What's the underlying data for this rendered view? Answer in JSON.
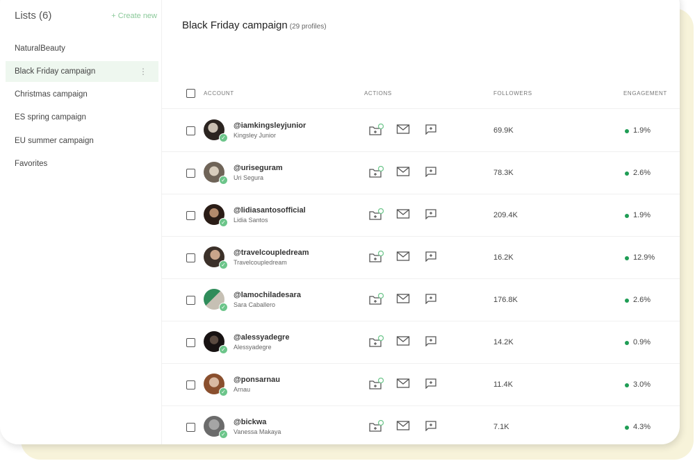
{
  "sidebar": {
    "title": "Lists (6)",
    "create_link": "+ Create new",
    "items": [
      {
        "label": "NaturalBeauty"
      },
      {
        "label": "Black Friday campaign"
      },
      {
        "label": "Christmas campaign"
      },
      {
        "label": "ES spring campaign"
      },
      {
        "label": "EU summer campaign"
      },
      {
        "label": "Favorites"
      }
    ],
    "active_index": 1,
    "menu_glyph": "⋮"
  },
  "main": {
    "title": "Black Friday campaign",
    "count": "(29 profiles)",
    "columns": {
      "account": "ACCOUNT",
      "actions": "ACTIONS",
      "followers": "FOLLOWERS",
      "engagement": "ENGAGEMENT"
    },
    "rows": [
      {
        "handle": "@iamkingsleyjunior",
        "name": "Kingsley Junior",
        "followers": "69.9K",
        "engagement": "1.9%"
      },
      {
        "handle": "@uriseguram",
        "name": "Uri Segura",
        "followers": "78.3K",
        "engagement": "2.6%"
      },
      {
        "handle": "@lidiasantosofficial",
        "name": "Lidia Santos",
        "followers": "209.4K",
        "engagement": "1.9%"
      },
      {
        "handle": "@travelcoupledream",
        "name": "Travelcoupledream",
        "followers": "16.2K",
        "engagement": "12.9%"
      },
      {
        "handle": "@lamochiladesara",
        "name": "Sara Caballero",
        "followers": "176.8K",
        "engagement": "2.6%"
      },
      {
        "handle": "@alessyadegre",
        "name": "Alessyadegre",
        "followers": "14.2K",
        "engagement": "0.9%"
      },
      {
        "handle": "@ponsarnau",
        "name": "Arnau",
        "followers": "11.4K",
        "engagement": "3.0%"
      },
      {
        "handle": "@bickwa",
        "name": "Vanessa Makaya",
        "followers": "7.1K",
        "engagement": "4.3%"
      }
    ]
  },
  "colors": {
    "accent_green": "#1f9d55",
    "create_link": "#8bc99a",
    "active_bg": "#eef7ef",
    "verified": "#6cc58a"
  },
  "icons": {
    "row_actions": [
      "folder-add-icon",
      "mail-icon",
      "message-icon"
    ],
    "verified": "check-icon"
  }
}
